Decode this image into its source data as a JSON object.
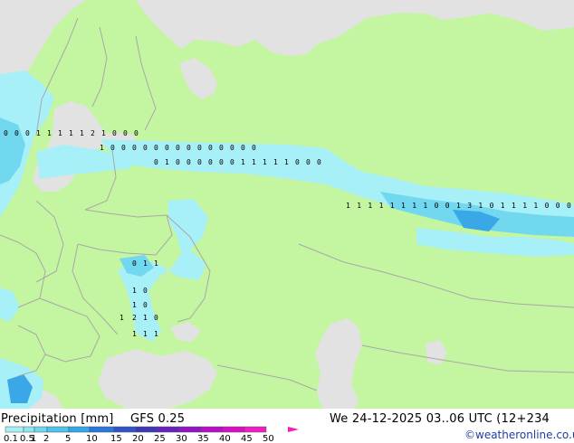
{
  "product": {
    "parameter": "Precipitation [mm]",
    "model": "GFS 0.25",
    "datetime": "We 24-12-2025 03..06 UTC (12+234"
  },
  "credit": "©weatheronline.co.uk",
  "legend": {
    "ticks": [
      "0.1",
      "0.5",
      "1",
      "2",
      "5",
      "10",
      "15",
      "20",
      "25",
      "30",
      "35",
      "40",
      "45",
      "50"
    ],
    "colors": [
      "#a8f0f8",
      "#8ce6f4",
      "#6fd6ef",
      "#4fc4ea",
      "#32a8e6",
      "#2a78db",
      "#2f54c9",
      "#3a3ab5",
      "#6a1fc0",
      "#9214c8",
      "#b80fc8",
      "#d80fc4",
      "#f01ec2"
    ]
  },
  "colors": {
    "land": "#c4f5a0",
    "sea": "#e2e2e2",
    "border": "#a8a8a8",
    "precip_light": "#a8f0f8",
    "precip_mid": "#72d8f0",
    "precip_strong": "#3aa8e6"
  },
  "station_values": [
    {
      "name": "scandinavia",
      "values": [
        "0",
        "0",
        "0",
        "1",
        "1",
        "1",
        "1",
        "1",
        "2",
        "1",
        "0",
        "0",
        "0"
      ]
    },
    {
      "name": "baltic-band",
      "values": [
        "1",
        "0",
        "0",
        "0",
        "0",
        "0",
        "0",
        "0",
        "0",
        "0",
        "0",
        "0",
        "0",
        "0",
        "0"
      ]
    },
    {
      "name": "central-russia-band",
      "values": [
        "0",
        "1",
        "0",
        "0",
        "0",
        "0",
        "0",
        "0",
        "1",
        "1",
        "1",
        "1",
        "1",
        "0",
        "0",
        "0"
      ]
    },
    {
      "name": "ural-band",
      "values": [
        "1",
        "1",
        "1",
        "1",
        "1",
        "1",
        "1",
        "1",
        "0",
        "0",
        "1",
        "3",
        "1",
        "0",
        "1",
        "1",
        "1",
        "1",
        "0",
        "0",
        "0"
      ]
    },
    {
      "name": "black-sea-coast",
      "values": [
        "0",
        "1",
        "1",
        "1",
        "0",
        "1",
        "0",
        "1",
        "2",
        "1",
        "0",
        "1",
        "1",
        "1"
      ]
    }
  ]
}
